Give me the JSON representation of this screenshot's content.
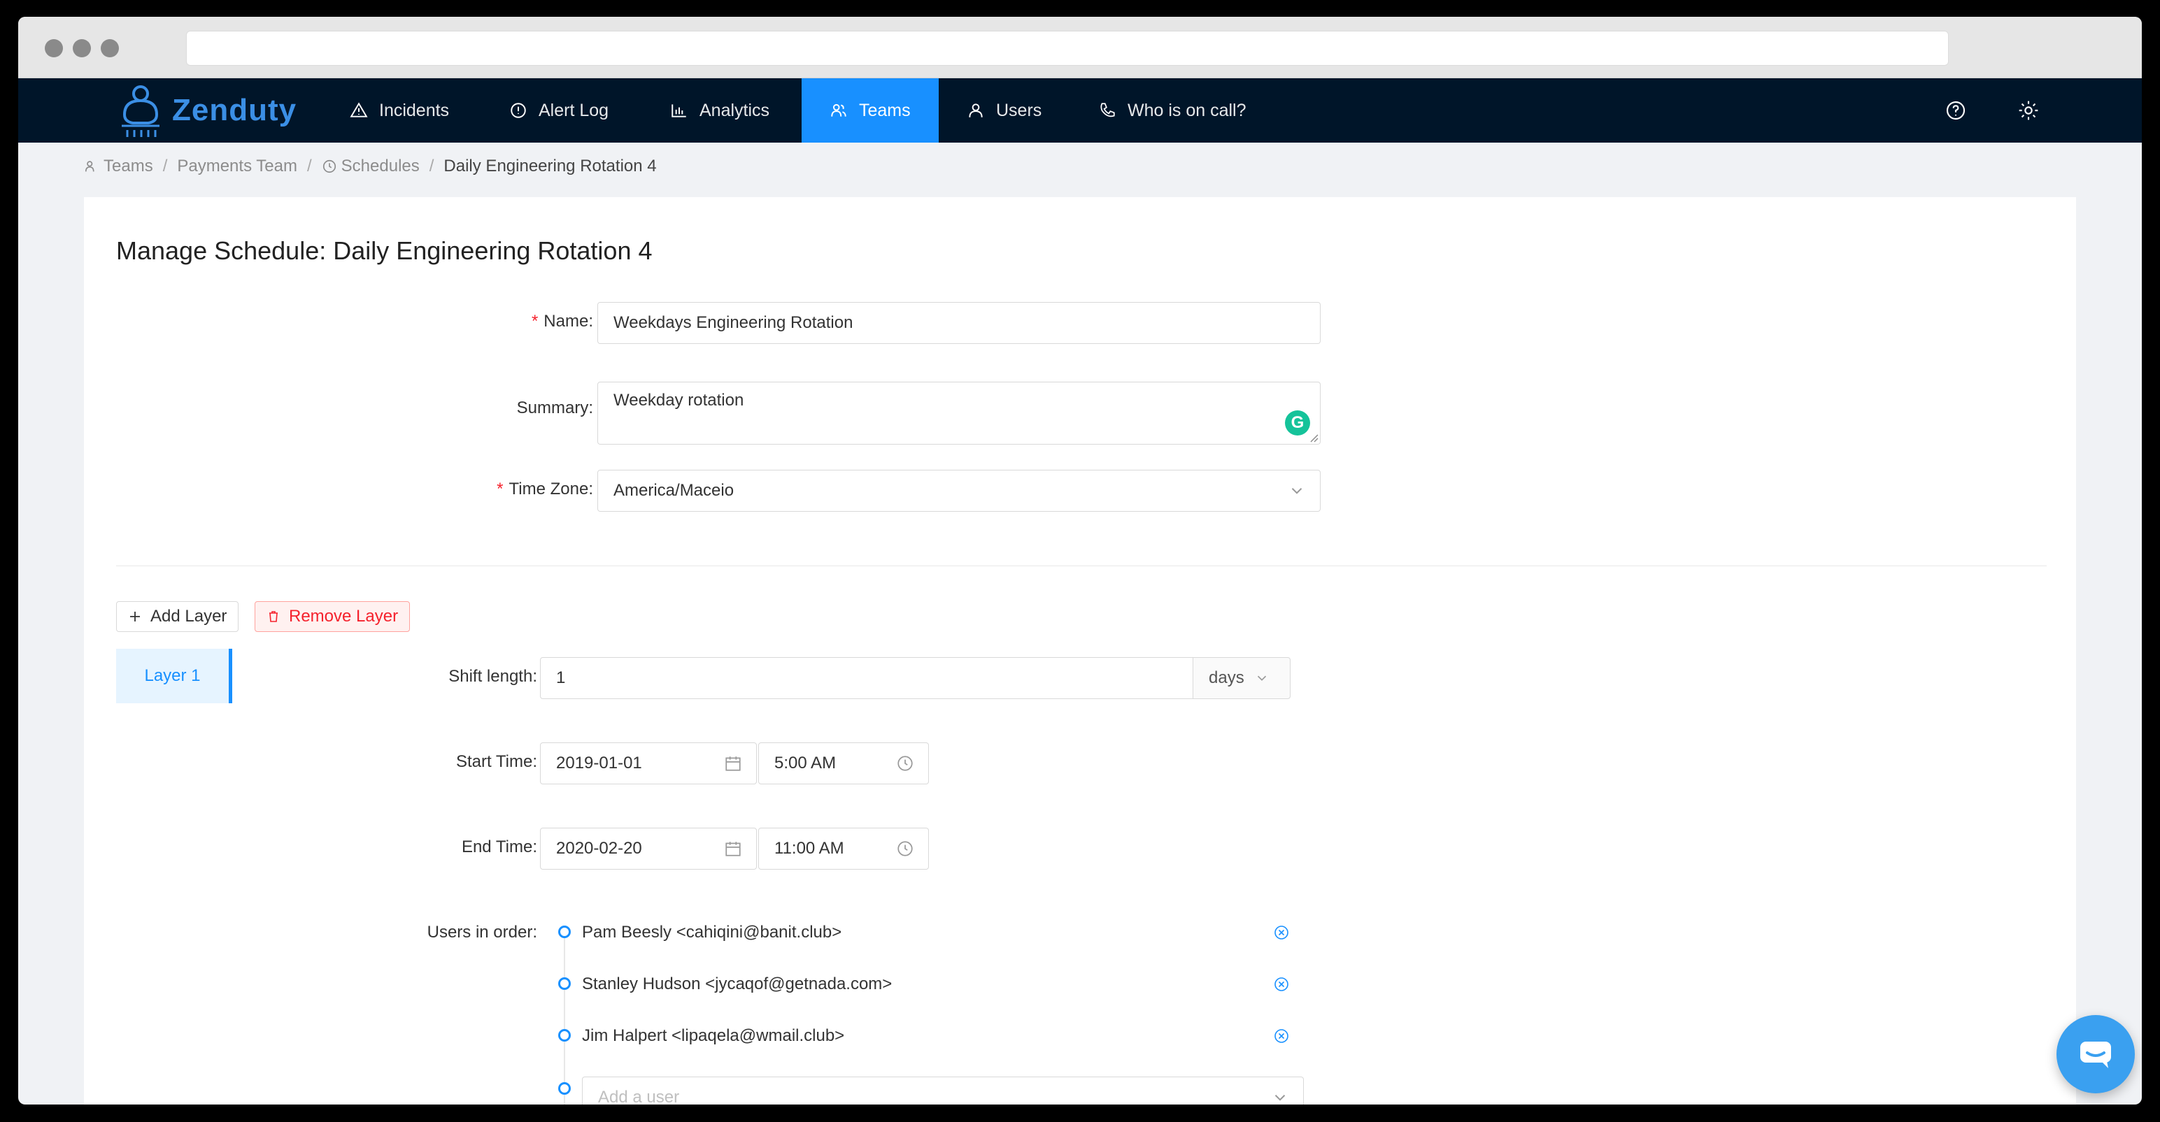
{
  "nav": {
    "brand": "Zenduty",
    "items": [
      {
        "label": "Incidents",
        "icon": "warning-icon"
      },
      {
        "label": "Alert Log",
        "icon": "info-icon"
      },
      {
        "label": "Analytics",
        "icon": "bar-chart-icon"
      },
      {
        "label": "Teams",
        "icon": "team-icon",
        "active": true
      },
      {
        "label": "Users",
        "icon": "user-icon"
      },
      {
        "label": "Who is on call?",
        "icon": "phone-icon"
      }
    ],
    "right_icons": [
      "help-icon",
      "settings-icon"
    ],
    "accent_color": "#1890ff",
    "background_color": "#001529"
  },
  "breadcrumb": {
    "teams": "Teams",
    "team": "Payments Team",
    "schedules": "Schedules",
    "current": "Daily Engineering Rotation 4"
  },
  "page": {
    "title": "Manage Schedule: Daily Engineering Rotation 4"
  },
  "form": {
    "name_label": "Name",
    "name_value": "Weekdays Engineering Rotation",
    "summary_label": "Summary",
    "summary_value": "Weekday rotation",
    "timezone_label": "Time Zone",
    "timezone_value": "America/Maceio"
  },
  "layers": {
    "add_label": "Add Layer",
    "remove_label": "Remove Layer",
    "tabs": [
      "Layer 1"
    ]
  },
  "layer": {
    "shift_length_label": "Shift length",
    "shift_length_value": "1",
    "shift_unit": "days",
    "start_time_label": "Start Time",
    "start_date": "2019-01-01",
    "start_time": "5:00 AM",
    "end_time_label": "End Time",
    "end_date": "2020-02-20",
    "end_time": "11:00 AM",
    "users_label": "Users in order",
    "users": [
      "Pam Beesly <cahiqini@banit.club>",
      "Stanley Hudson <jycaqof@getnada.com>",
      "Jim Halpert <lipaqela@wmail.club>"
    ],
    "add_user_placeholder": "Add a user"
  }
}
